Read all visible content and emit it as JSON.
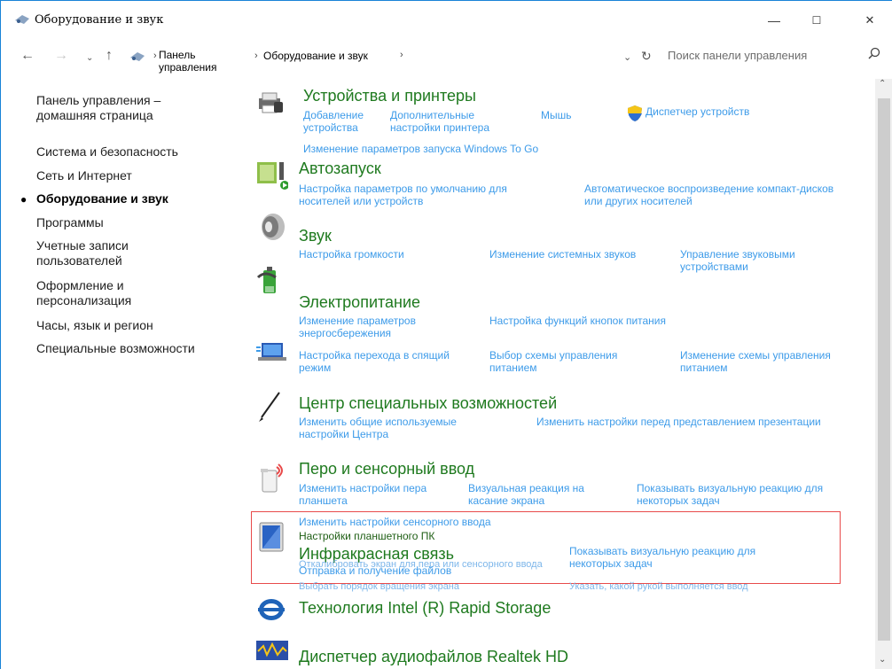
{
  "window": {
    "title": "Оборудование и звук",
    "minimize": "—",
    "maximize": "☐",
    "close": "✕"
  },
  "address": {
    "crumb1_line1": "Панель",
    "crumb1_line2": "управления",
    "crumb2": "Оборудование и звук",
    "search_placeholder": "Поиск панели управления"
  },
  "sidebar": {
    "items": [
      {
        "line1": "Панель управления –",
        "line2": "домашняя страница"
      },
      {
        "line1": "Система и безопасность",
        "line2": ""
      },
      {
        "line1": "Сеть и Интернет",
        "line2": ""
      },
      {
        "line1": "Оборудование и звук",
        "line2": "",
        "active": true
      },
      {
        "line1": "Программы",
        "line2": ""
      },
      {
        "line1": "Учетные записи",
        "line2": "пользователей"
      },
      {
        "line1": "Оформление и",
        "line2": "персонализация"
      },
      {
        "line1": "Часы, язык и регион",
        "line2": ""
      },
      {
        "line1": "Специальные возможности",
        "line2": ""
      }
    ]
  },
  "categories": {
    "devices": {
      "title": "Устройства и принтеры",
      "links": [
        "Добавление\nустройства",
        "Дополнительные\nнастройки принтера",
        "Мышь",
        "Диспетчер устройств",
        "Изменение параметров запуска Windows To Go"
      ]
    },
    "autoplay": {
      "title": "Автозапуск",
      "links": [
        "Настройка параметров по умолчанию для\nносителей или устройств",
        "Автоматическое воспроизведение компакт-дисков\nили других носителей"
      ]
    },
    "sound": {
      "title": "Звук",
      "links": [
        "Настройка громкости",
        "Изменение системных звуков",
        "Управление звуковыми\nустройствами"
      ]
    },
    "power": {
      "title": "Электропитание",
      "links": [
        "Изменение параметров\nэнергосбережения",
        "Настройка функций кнопок питания",
        "Настройка перехода в спящий\nрежим",
        "Выбор схемы управления\nпитанием",
        "Изменение схемы управления\nпитанием"
      ]
    },
    "ease": {
      "title": "Центр специальных возможностей",
      "links": [
        "Изменить общие используемые\nнастройки Центра",
        "Изменить настройки перед представлением презентации"
      ]
    },
    "pen": {
      "title": "Перо и сенсорный ввод",
      "links": [
        "Изменить настройки пера\nпланшета",
        "Визуальная реакция на\nкасание экрана",
        "Показывать визуальную реакцию для\nнекоторых задач"
      ]
    },
    "tablet": {
      "link_touch": "Изменить настройки сенсорного ввода",
      "title": "Настройки планшетного ПК",
      "ghost1": "Откалибровать экран для пера или сенсорного ввода",
      "ghost2": "Выбрать порядок вращения экрана",
      "ghost3": "Указать, какой рукой выполняется ввод",
      "right_link": "Показывать визуальную реакцию для\nнекоторых задач"
    },
    "infrared": {
      "title": "Инфракрасная связь",
      "link": "Отправка и получение файлов"
    },
    "intel": {
      "title": "Технология Intel (R) Rapid Storage"
    },
    "realtek": {
      "title": "Диспетчер аудиофайлов Realtek HD"
    }
  },
  "colors": {
    "accent": "#3d9be9",
    "category": "#1f7a1f",
    "highlight": "#e84a4a"
  }
}
